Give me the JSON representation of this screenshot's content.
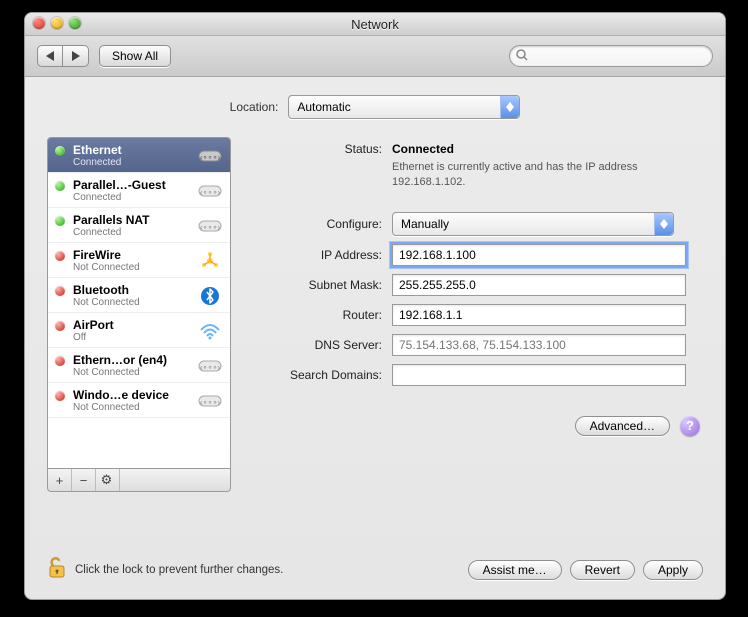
{
  "window": {
    "title": "Network"
  },
  "toolbar": {
    "show_all": "Show All",
    "search_placeholder": ""
  },
  "location": {
    "label": "Location:",
    "value": "Automatic"
  },
  "sidebar": {
    "items": [
      {
        "name": "Ethernet",
        "sub": "Connected",
        "status": "green",
        "icon": "link",
        "selected": true
      },
      {
        "name": "Parallel…-Guest",
        "sub": "Connected",
        "status": "green",
        "icon": "link",
        "selected": false
      },
      {
        "name": "Parallels NAT",
        "sub": "Connected",
        "status": "green",
        "icon": "link",
        "selected": false
      },
      {
        "name": "FireWire",
        "sub": "Not Connected",
        "status": "red",
        "icon": "firewire",
        "selected": false
      },
      {
        "name": "Bluetooth",
        "sub": "Not Connected",
        "status": "red",
        "icon": "bluetooth",
        "selected": false
      },
      {
        "name": "AirPort",
        "sub": "Off",
        "status": "red",
        "icon": "wifi",
        "selected": false
      },
      {
        "name": "Ethern…or (en4)",
        "sub": "Not Connected",
        "status": "red",
        "icon": "link",
        "selected": false
      },
      {
        "name": "Windo…e device",
        "sub": "Not Connected",
        "status": "red",
        "icon": "link",
        "selected": false
      }
    ],
    "add": "+",
    "remove": "−",
    "gear": "⚙"
  },
  "detail": {
    "status_label": "Status:",
    "status_value": "Connected",
    "status_desc": "Ethernet is currently active and has the IP address 192.168.1.102.",
    "configure_label": "Configure:",
    "configure_value": "Manually",
    "ip_label": "IP Address:",
    "ip_value": "192.168.1.100",
    "subnet_label": "Subnet Mask:",
    "subnet_value": "255.255.255.0",
    "router_label": "Router:",
    "router_value": "192.168.1.1",
    "dns_label": "DNS Server:",
    "dns_placeholder": "75.154.133.68, 75.154.133.100",
    "search_label": "Search Domains:",
    "search_value": "",
    "advanced": "Advanced…"
  },
  "footer": {
    "lock_text": "Click the lock to prevent further changes.",
    "assist": "Assist me…",
    "revert": "Revert",
    "apply": "Apply"
  }
}
